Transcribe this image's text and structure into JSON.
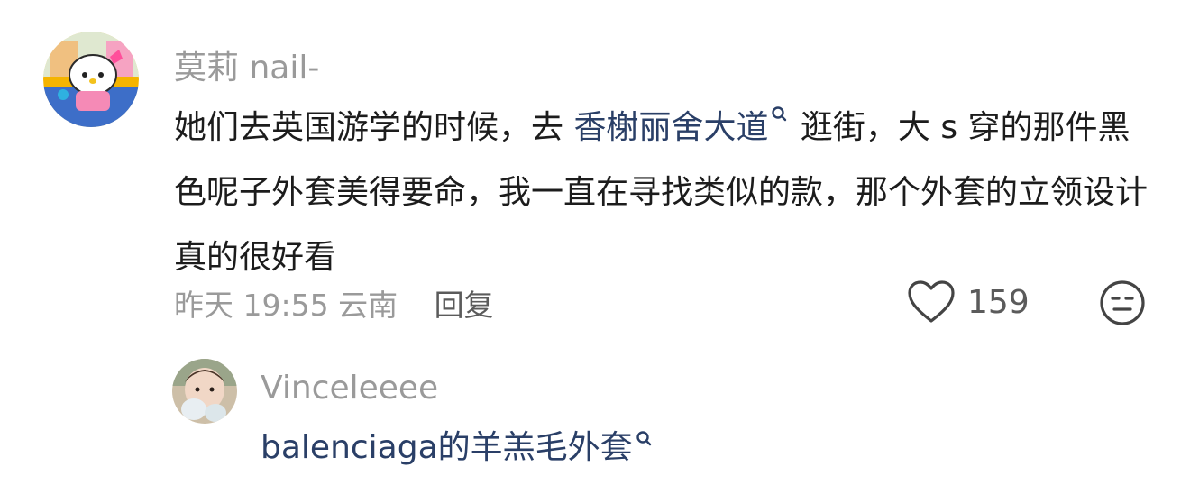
{
  "comment": {
    "username": "莫莉 nail-",
    "text_before": "她们去英国游学的时候，去 ",
    "link_text": "香榭丽舍大道",
    "text_after": " 逛街，大 s 穿的那件黑色呢子外套美得要命，我一直在寻找类似的款，那个外套的立领设计真的很好看",
    "time": "昨天 19:55",
    "location": "云南",
    "reply_label": "回复",
    "like_count": "159"
  },
  "reply": {
    "username": "Vinceleeee",
    "link_text": "balenciaga的羊羔毛外套"
  },
  "colors": {
    "link": "#2a3f67",
    "muted": "#9a9a9a",
    "text": "#1c1c1c"
  },
  "icons": {
    "search_mark": "search-icon",
    "like": "heart-icon",
    "emoji": "emoji-icon"
  }
}
